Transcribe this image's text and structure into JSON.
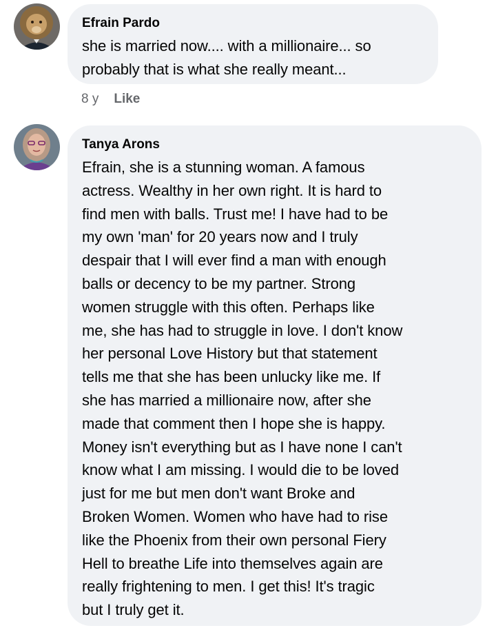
{
  "comments": [
    {
      "author": "Efrain Pardo",
      "text": "she is married now.... with a millionaire... so\nprobably that is what she really meant...",
      "time": "8 y",
      "like_label": "Like",
      "avatar_icon": "lion-avatar-icon"
    },
    {
      "author": "Tanya Arons",
      "text": "Efrain, she is a stunning woman. A famous\nactress.  Wealthy in her own right.  It is hard to\nfind men with balls.  Trust me!  I have had to be\nmy own 'man' for 20 years now and I truly\ndespair that I will ever find a man with enough\nballs or decency to be my partner.  Strong\nwomen struggle with this often.  Perhaps like\nme, she has had to struggle in love.  I don't know\nher personal Love History but that statement\ntells me that she has been unlucky like me.  If\nshe has married a millionaire now, after she\nmade that comment then I hope she is happy.\nMoney isn't everything but as I have none I can't\nknow what I am missing.  I would die to be loved\njust for me but men don't want Broke and\nBroken Women.  Women who have had to rise\nlike the Phoenix from their own personal Fiery\nHell to breathe Life into themselves again are\nreally frightening to men.  I get this! It's tragic\nbut I truly get it.",
      "avatar_icon": "woman-avatar-icon"
    }
  ],
  "colors": {
    "bubble": "#f0f2f5",
    "text": "#050505",
    "secondary": "#65676b"
  }
}
